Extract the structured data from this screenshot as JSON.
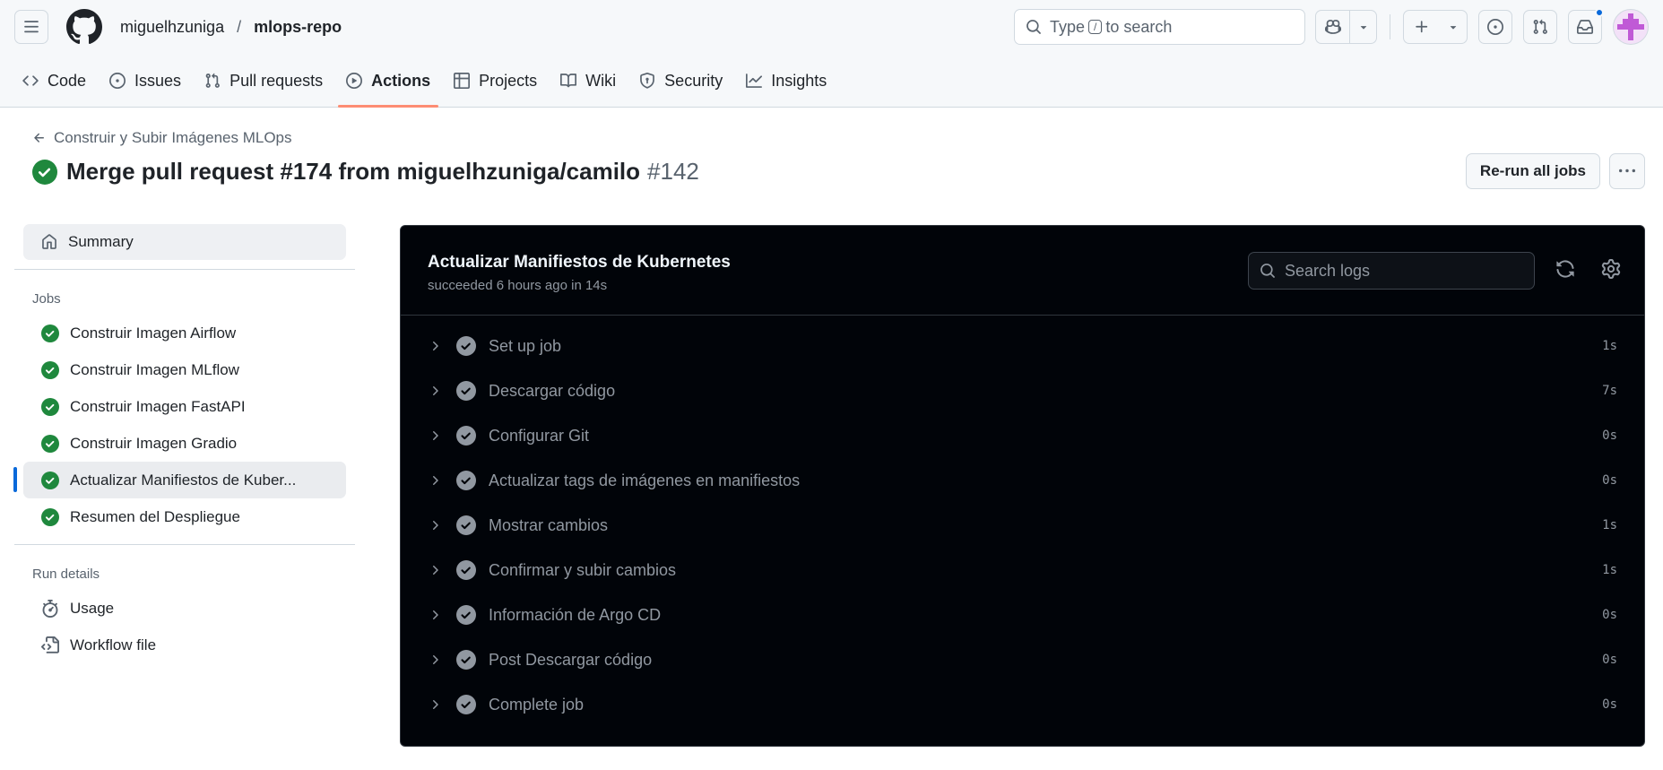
{
  "header": {
    "owner": "miguelhzuniga",
    "separator": "/",
    "repo": "mlops-repo",
    "search": {
      "prefix": "Type",
      "key": "/",
      "suffix": "to search"
    }
  },
  "tabs": [
    {
      "label": "Code",
      "icon": "code-icon",
      "active": false
    },
    {
      "label": "Issues",
      "icon": "issue-icon",
      "active": false
    },
    {
      "label": "Pull requests",
      "icon": "pull-request-icon",
      "active": false
    },
    {
      "label": "Actions",
      "icon": "play-icon",
      "active": true
    },
    {
      "label": "Projects",
      "icon": "table-icon",
      "active": false
    },
    {
      "label": "Wiki",
      "icon": "book-icon",
      "active": false
    },
    {
      "label": "Security",
      "icon": "shield-icon",
      "active": false
    },
    {
      "label": "Insights",
      "icon": "graph-icon",
      "active": false
    }
  ],
  "run": {
    "back_label": "Construir y Subir Imágenes MLOps",
    "title": "Merge pull request #174 from miguelhzuniga/camilo",
    "number": "#142",
    "rerun_label": "Re-run all jobs"
  },
  "sidebar": {
    "summary_label": "Summary",
    "jobs_heading": "Jobs",
    "jobs": [
      {
        "label": "Construir Imagen Airflow",
        "selected": false
      },
      {
        "label": "Construir Imagen MLflow",
        "selected": false
      },
      {
        "label": "Construir Imagen FastAPI",
        "selected": false
      },
      {
        "label": "Construir Imagen Gradio",
        "selected": false
      },
      {
        "label": "Actualizar Manifiestos de Kuber...",
        "selected": true
      },
      {
        "label": "Resumen del Despliegue",
        "selected": false
      }
    ],
    "details_heading": "Run details",
    "usage_label": "Usage",
    "workflow_label": "Workflow file"
  },
  "log": {
    "title": "Actualizar Manifiestos de Kubernetes",
    "subtitle": "succeeded 6 hours ago in 14s",
    "search_placeholder": "Search logs",
    "steps": [
      {
        "name": "Set up job",
        "duration": "1s"
      },
      {
        "name": "Descargar código",
        "duration": "7s"
      },
      {
        "name": "Configurar Git",
        "duration": "0s"
      },
      {
        "name": "Actualizar tags de imágenes en manifiestos",
        "duration": "0s"
      },
      {
        "name": "Mostrar cambios",
        "duration": "1s"
      },
      {
        "name": "Confirmar y subir cambios",
        "duration": "1s"
      },
      {
        "name": "Información de Argo CD",
        "duration": "0s"
      },
      {
        "name": "Post Descargar código",
        "duration": "0s"
      },
      {
        "name": "Complete job",
        "duration": "0s"
      }
    ]
  },
  "colors": {
    "success": "#1f883d",
    "active_tab_underline": "#fd8c73",
    "selected_marker": "#0969da",
    "log_background": "#010409",
    "notification_dot": "#0969da"
  }
}
